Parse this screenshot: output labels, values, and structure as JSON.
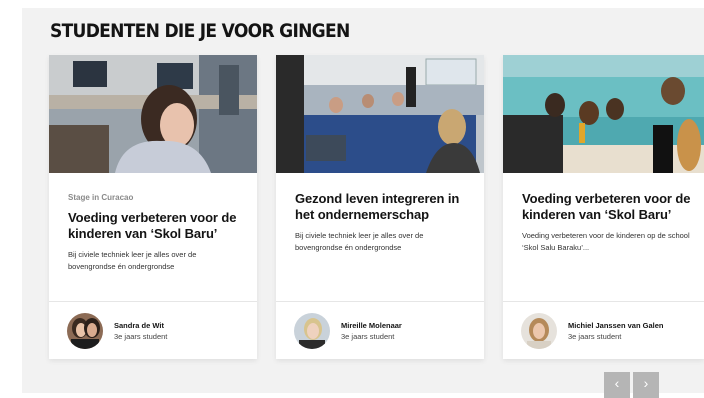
{
  "section": {
    "heading": "STUDENTEN DIE JE VOOR GINGEN"
  },
  "cards": [
    {
      "eyebrow": "Stage in Curacao",
      "title": "Voeding verbeteren voor de kinderen van ‘Skol Baru’",
      "description": "Bij civiele techniek leer je alles over de bovengrondse én ondergrondse",
      "author_name": "Sandra de Wit",
      "author_role": "3e jaars student"
    },
    {
      "eyebrow": "",
      "title": "Gezond leven integreren in het ondernemerschap",
      "description": "Bij civiele techniek leer je alles over de bovengrondse én ondergrondse",
      "author_name": "Mireille Molenaar",
      "author_role": "3e jaars student"
    },
    {
      "eyebrow": "",
      "title": "Voeding verbeteren voor de kinderen van ‘Skol Baru’",
      "description": "Voeding verbeteren voor de kinderen op de school ‘Skol Salu Baraku’...",
      "author_name": "Michiel Janssen van Galen",
      "author_role": "3e jaars student"
    }
  ],
  "carousel": {
    "prev_icon": "chevron-left-icon",
    "next_icon": "chevron-right-icon",
    "prev_glyph": "‹",
    "next_glyph": "›"
  },
  "colors": {
    "section_bg": "#f2f2f2",
    "card_bg": "#ffffff",
    "heading": "#141414",
    "nav_button": "#b5b5b5"
  }
}
